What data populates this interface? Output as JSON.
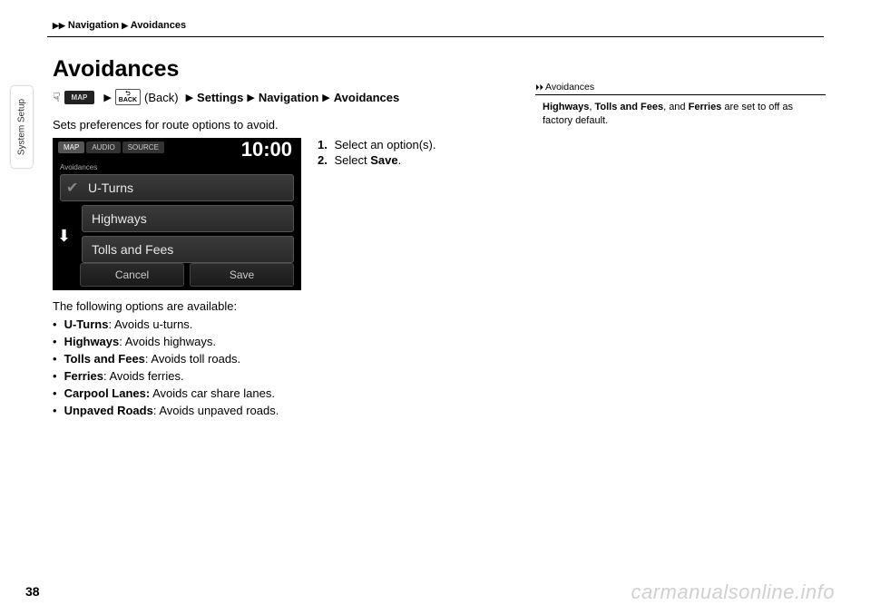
{
  "breadcrumb": {
    "nav": "Navigation",
    "page": "Avoidances"
  },
  "sideTab": "System Setup",
  "title": "Avoidances",
  "navPath": {
    "mapLabel": "MAP",
    "backBox": "⮌\nBACK",
    "backText": "(Back)",
    "settings": "Settings",
    "navigation": "Navigation",
    "avoidances": "Avoidances"
  },
  "intro": "Sets preferences for route options to avoid.",
  "screenshot": {
    "tabs": {
      "map": "MAP",
      "audio": "AUDIO",
      "source": "SOURCE"
    },
    "clock": "10:00",
    "sublabel": "Avoidances",
    "items": {
      "uturns": "U-Turns",
      "highways": "Highways",
      "tolls": "Tolls and Fees"
    },
    "cancel": "Cancel",
    "save": "Save"
  },
  "following": "The following options are available:",
  "options": {
    "uturns": {
      "name": "U-Turns",
      "desc": ": Avoids u-turns."
    },
    "highways": {
      "name": "Highways",
      "desc": ": Avoids highways."
    },
    "tolls": {
      "name": "Tolls and Fees",
      "desc": ": Avoids toll roads."
    },
    "ferries": {
      "name": "Ferries",
      "desc": ": Avoids ferries."
    },
    "carpool": {
      "name": "Carpool Lanes:",
      "desc": " Avoids car share lanes."
    },
    "unpaved": {
      "name": "Unpaved Roads",
      "desc": ": Avoids unpaved roads."
    }
  },
  "steps": {
    "s1num": "1.",
    "s1": " Select an option(s).",
    "s2num": "2.",
    "s2a": " Select ",
    "s2b": "Save",
    "s2c": "."
  },
  "right": {
    "heading": "Avoidances",
    "b1": "Highways",
    "punct": ", ",
    "b2": "Tolls and Fees",
    "punct2": ", and ",
    "b3": "Ferries",
    "rest": " are set to off as factory default."
  },
  "pageNumber": "38",
  "watermark": "carmanualsonline.info"
}
